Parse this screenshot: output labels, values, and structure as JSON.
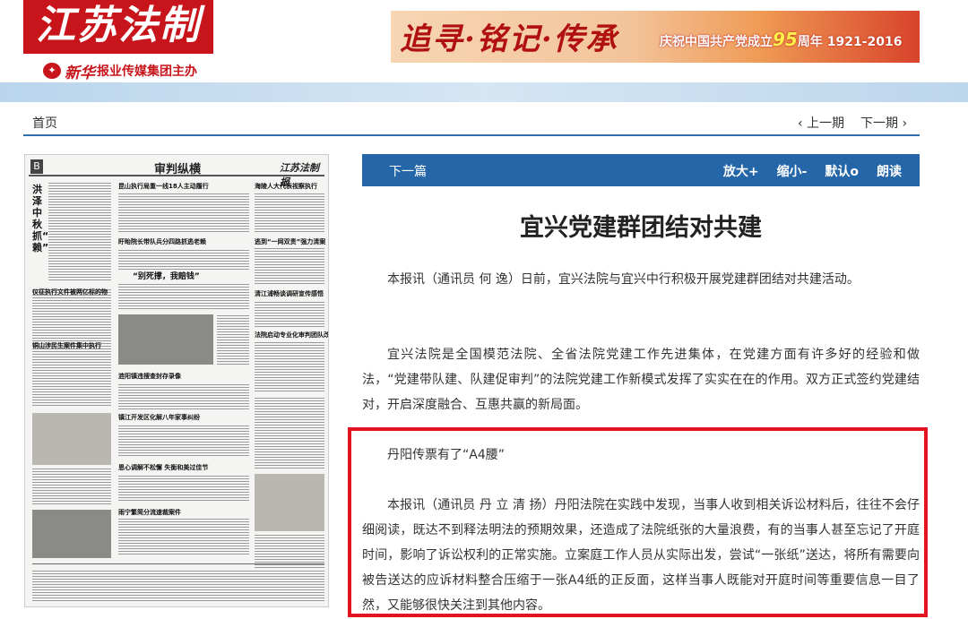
{
  "header": {
    "logo": "江苏法制报",
    "sub_brand": "新华",
    "sub_text": "报业传媒集团主办",
    "banner_slogan": "追寻·铭记·传承",
    "banner_text_prefix": "庆祝中国共产党成立",
    "banner_number": "95",
    "banner_text_suffix": "周年 1921-2016"
  },
  "nav": {
    "home": "首页",
    "prev": "‹ 上一期",
    "next": "下一期 ›"
  },
  "paper": {
    "page_letter": "B",
    "section": "审判纵横",
    "logo": "江苏法制报",
    "vertical_headline": "洪泽中秋抓“老赖”",
    "headlines": [
      "昆山执行局重一线18人主动履行",
      "海陵人大代表视察执行",
      "盱眙院长带队兵分四路抓逃老赖",
      "逃到“一网双责”强力清案",
      "仪征执行文件被两亿标的物",
      "“别死撑，我赔钱”",
      "清江浦畅谈调研宣传感悟",
      "铜山涉民生案件集中执行",
      "涟阳镇违搜查封存录像",
      "法院启动专业化审判团队改革模式",
      "镇江开发区化解八年家事纠纷",
      "恩心调解不松懈 失衡和美过佳节",
      "雨宁繁简分流速裁案件"
    ]
  },
  "toolbar": {
    "next_article": "下一篇",
    "zoom_in": "放大+",
    "zoom_out": "缩小-",
    "default": "默认o",
    "read": "朗读"
  },
  "article": {
    "title": "宜兴党建群团结对共建",
    "paragraphs": [
      "本报讯（通讯员  何  逸）日前，宜兴法院与宜兴中行积极开展党建群团结对共建活动。",
      "宜兴法院是全国模范法院、全省法院党建工作先进集体，在党建方面有许多好的经验和做法，“党建带队建、队建促审判”的法院党建工作新模式发挥了实实在在的作用。双方正式签约党建结对，开启深度融合、互惠共赢的新局面。",
      "丹阳传票有了“A4腰”",
      "本报讯（通讯员  丹  立  清  扬）丹阳法院在实践中发现，当事人收到相关诉讼材料后，往往不会仔细阅读，既达不到释法明法的预期效果，还造成了法院纸张的大量浪费，有的当事人甚至忘记了开庭时间，影响了诉讼权利的正常实施。立案庭工作人员从实际出发，尝试“一张纸”送达，将所有需要向被告送达的应诉材料整合压缩于一张A4纸的正反面，这样当事人既能对开庭时间等重要信息一目了然，又能够很快关注到其他内容。"
    ]
  },
  "colors": {
    "brand_red": "#c8151b",
    "toolbar_blue": "#2466a8",
    "highlight_red": "#e3141f"
  }
}
